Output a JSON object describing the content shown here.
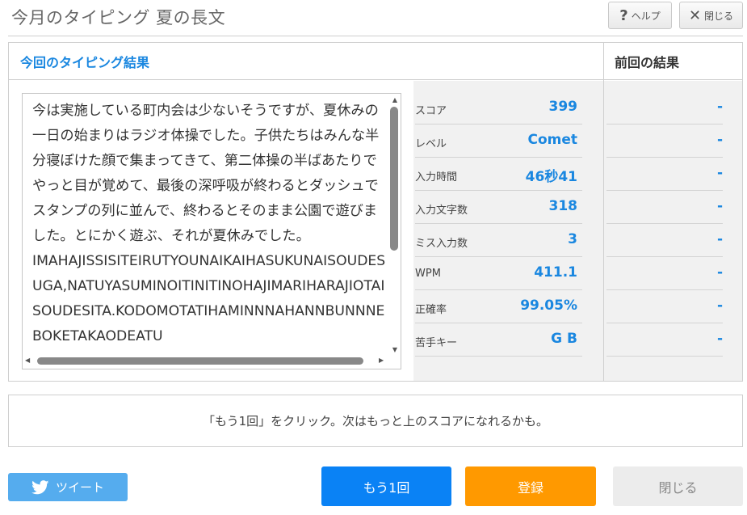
{
  "header": {
    "title": "今月のタイピング 夏の長文",
    "help_label": "ヘルプ",
    "close_label": "閉じる"
  },
  "panel": {
    "current_heading": "今回のタイピング結果",
    "previous_heading": "前回の結果"
  },
  "typed_text": "今は実施している町内会は少ないそうですが、夏休みの一日の始まりはラジオ体操でした。子供たちはみんな半分寝ぼけた顔で集まってきて、第二体操の半ばあたりでやっと目が覚めて、最後の深呼吸が終わるとダッシュでスタンプの列に並んで、終わるとそのまま公園で遊びました。とにかく遊ぶ、それが夏休みでした。\nIMAHAJISSISITEIRUTYOUNAIKAIHASUKUNAISOUDESUGA,NATUYASUMINOITINITINOHAJIMARIHARAJIOTAISOUDESITA.KODOMOTATIHAMINNNAHANNBUNNNEBOKETAKAODEATU",
  "stats": [
    {
      "label": "スコア",
      "value": "399",
      "previous": "-"
    },
    {
      "label": "レベル",
      "value": "Comet",
      "previous": "-"
    },
    {
      "label": "入力時間",
      "value": "46秒41",
      "previous": "-"
    },
    {
      "label": "入力文字数",
      "value": "318",
      "previous": "-"
    },
    {
      "label": "ミス入力数",
      "value": "3",
      "previous": "-"
    },
    {
      "label": "WPM",
      "value": "411.1",
      "previous": "-"
    },
    {
      "label": "正確率",
      "value": "99.05%",
      "previous": "-"
    },
    {
      "label": "苦手キー",
      "value": "G B",
      "previous": "-"
    }
  ],
  "message": "「もう1回」をクリック。次はもっと上のスコアになれるかも。",
  "buttons": {
    "tweet": "ツイート",
    "retry": "もう1回",
    "register": "登録",
    "close": "閉じる"
  },
  "colors": {
    "accent_blue": "#1a87e0",
    "retry_blue": "#0a82f5",
    "register_orange": "#ff9900",
    "twitter_blue": "#55acee"
  }
}
